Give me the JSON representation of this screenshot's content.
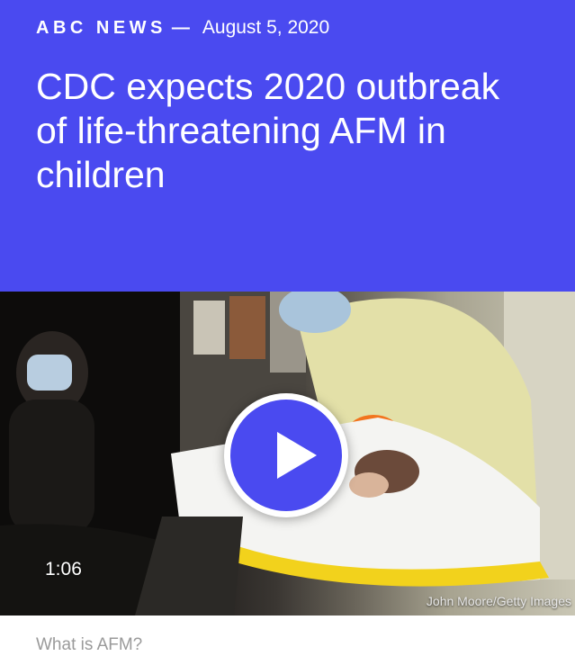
{
  "header": {
    "brand": "ABC NEWS",
    "separator": "—",
    "date": "August 5, 2020",
    "headline": "CDC expects 2020 outbreak of life-threatening AFM in children",
    "background_color": "#4a4af0"
  },
  "video": {
    "play_icon": "play-icon",
    "duration": "1:06",
    "credit": "John Moore/Getty Images",
    "button_color": "#4a4af0"
  },
  "footer": {
    "text": "What is AFM?"
  }
}
